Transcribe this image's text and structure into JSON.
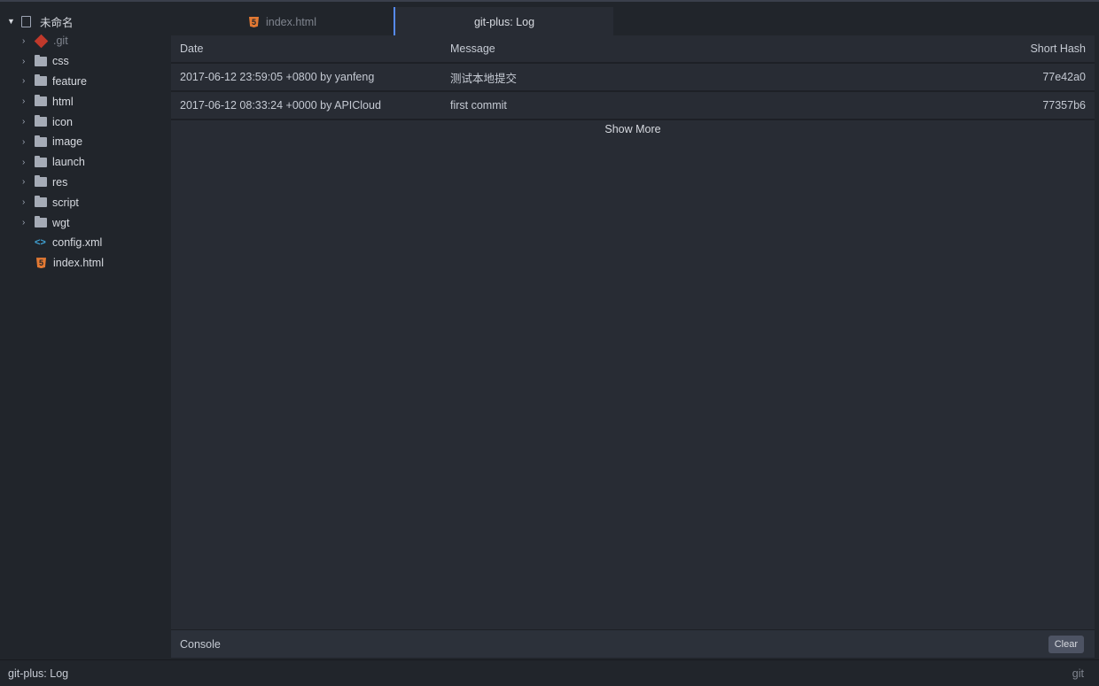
{
  "sidebar": {
    "project": "未命名",
    "items": [
      {
        "label": ".git",
        "type": "git"
      },
      {
        "label": "css",
        "type": "folder"
      },
      {
        "label": "feature",
        "type": "folder"
      },
      {
        "label": "html",
        "type": "folder"
      },
      {
        "label": "icon",
        "type": "folder"
      },
      {
        "label": "image",
        "type": "folder"
      },
      {
        "label": "launch",
        "type": "folder"
      },
      {
        "label": "res",
        "type": "folder"
      },
      {
        "label": "script",
        "type": "folder"
      },
      {
        "label": "wgt",
        "type": "folder"
      },
      {
        "label": "config.xml",
        "type": "xml"
      },
      {
        "label": "index.html",
        "type": "html"
      }
    ]
  },
  "tabs": [
    {
      "label": "index.html",
      "active": false
    },
    {
      "label": "git-plus: Log",
      "active": true
    }
  ],
  "log": {
    "headers": [
      "Date",
      "Message",
      "Short Hash"
    ],
    "rows": [
      {
        "date": "2017-06-12 23:59:05 +0800 by yanfeng",
        "message": "测试本地提交",
        "hash": "77e42a0"
      },
      {
        "date": "2017-06-12 08:33:24 +0000 by APICloud",
        "message": "first commit",
        "hash": "77357b6"
      }
    ],
    "show_more": "Show More"
  },
  "console": {
    "label": "Console",
    "clear": "Clear"
  },
  "status": {
    "left": "git-plus: Log",
    "right": "git"
  },
  "colors": {
    "accent": "#568af2",
    "background": "#282c34"
  }
}
